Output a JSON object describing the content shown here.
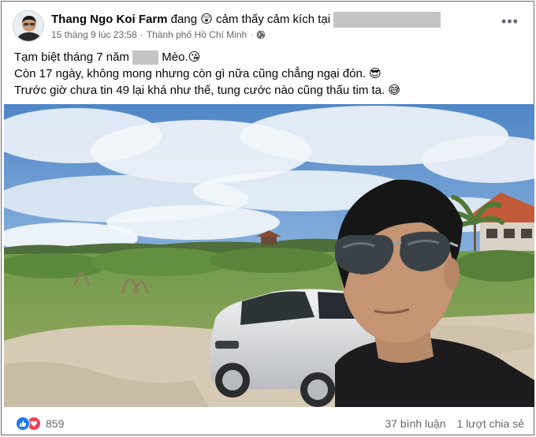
{
  "post": {
    "author": "Thang Ngo Koi Farm",
    "feeling_prefix": "đang",
    "feeling_emoji": "😲",
    "feeling_text": "cảm thấy cảm kích tại",
    "timestamp": "15 tháng 9 lúc 23:58",
    "separator": "·",
    "location": "Thành phố Hồ Chí Minh",
    "privacy_icon": "globe-icon",
    "more_icon": "ellipsis-icon",
    "caption": {
      "line1_start": "Tạm biệt tháng 7 năm",
      "line1_end": "Mèo.",
      "line1_emoji": "😘",
      "line2": "Còn 17 ngày, không mong nhưng còn gì nữa cũng chẳng ngại đón.",
      "line2_emoji": "😎",
      "line3": "Trước giờ chưa tin 49 lại khá như thế, tung cước nào cũng thấu tim ta.",
      "line3_emoji": "😅"
    }
  },
  "footer": {
    "reaction_icons": [
      "like-icon",
      "love-icon"
    ],
    "reaction_count": "859",
    "comments": "37 bình luận",
    "shares": "1 lượt chia sẻ"
  },
  "colors": {
    "like_blue": "#1877f2",
    "love_red": "#f33e58",
    "meta_gray": "#65676b",
    "redaction_gray": "#c4c4c4"
  }
}
